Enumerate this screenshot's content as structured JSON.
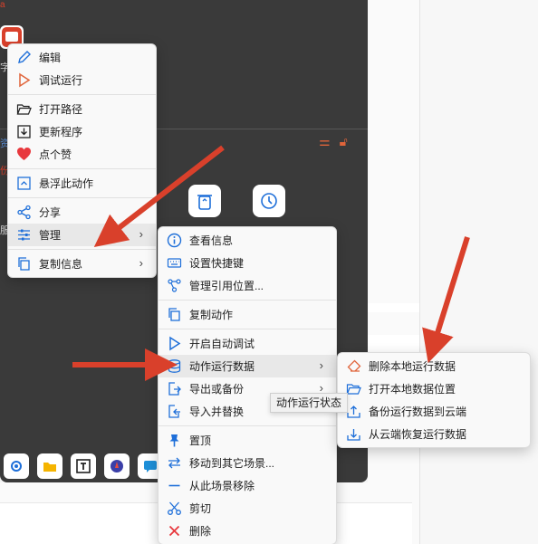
{
  "background": {
    "corner_red_char": "a",
    "left_app_label": "字",
    "left_side_labels": [
      "资",
      "份",
      "服"
    ]
  },
  "menu_main": {
    "items": [
      {
        "label": "编辑",
        "icon": "pencil-icon"
      },
      {
        "label": "调试运行",
        "icon": "play-outline-icon"
      },
      {
        "label": "打开路径",
        "icon": "folder-open-icon"
      },
      {
        "label": "更新程序",
        "icon": "download-box-icon"
      },
      {
        "label": "点个赞",
        "icon": "heart-icon"
      },
      {
        "label": "悬浮此动作",
        "icon": "float-up-icon"
      },
      {
        "label": "分享",
        "icon": "share-icon",
        "submenu": true
      },
      {
        "label": "管理",
        "icon": "sliders-icon",
        "submenu": true,
        "highlighted": true
      },
      {
        "label": "复制信息",
        "icon": "copy-icon",
        "submenu": true
      }
    ]
  },
  "menu_manage": {
    "items": [
      {
        "label": "查看信息",
        "icon": "info-icon"
      },
      {
        "label": "设置快捷键",
        "icon": "keyboard-icon"
      },
      {
        "label": "管理引用位置...",
        "icon": "graph-icon"
      },
      {
        "label": "复制动作",
        "icon": "copy-icon"
      },
      {
        "label": "开启自动调试",
        "icon": "play-outline-icon"
      },
      {
        "label": "动作运行数据",
        "icon": "database-icon",
        "submenu": true,
        "highlighted": true
      },
      {
        "label": "导出或备份",
        "icon": "export-icon",
        "submenu": true
      },
      {
        "label": "导入并替换",
        "icon": "import-icon"
      },
      {
        "label": "置顶",
        "icon": "pin-icon"
      },
      {
        "label": "移动到其它场景...",
        "icon": "move-icon"
      },
      {
        "label": "从此场景移除",
        "icon": "minus-icon"
      },
      {
        "label": "剪切",
        "icon": "scissors-icon"
      },
      {
        "label": "删除",
        "icon": "close-red-icon"
      }
    ]
  },
  "menu_data": {
    "items": [
      {
        "label": "删除本地运行数据",
        "icon": "eraser-icon"
      },
      {
        "label": "打开本地数据位置",
        "icon": "folder-open-icon"
      },
      {
        "label": "备份运行数据到云端",
        "icon": "cloud-upload-icon"
      },
      {
        "label": "从云端恢复运行数据",
        "icon": "cloud-download-icon"
      }
    ]
  },
  "tooltip": {
    "text": "动作运行状态"
  },
  "colors": {
    "accent_blue": "#1e6fd9",
    "arrow_red": "#d9402b",
    "heart_red": "#e8383d"
  }
}
